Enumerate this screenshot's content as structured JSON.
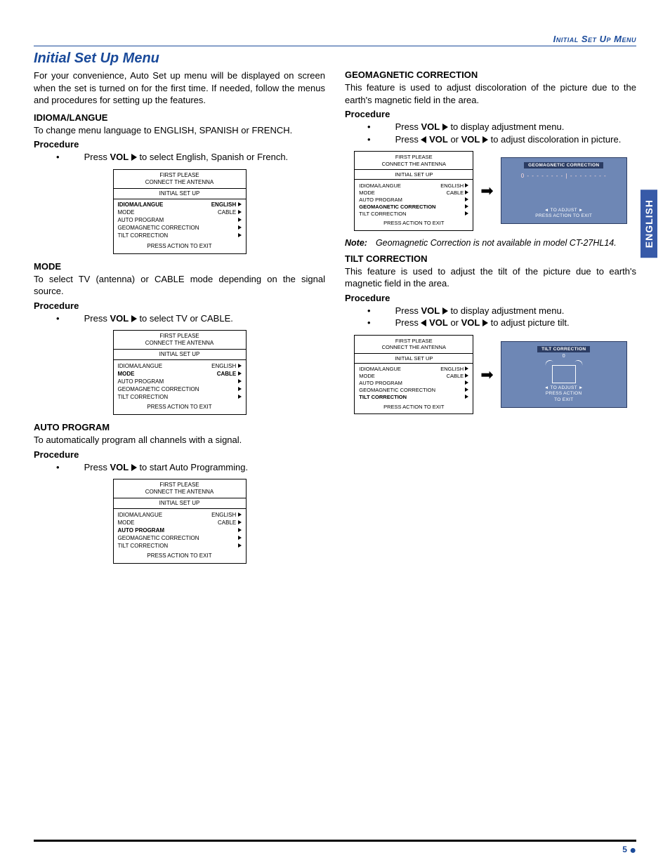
{
  "header": {
    "tab_label": "ENGLISH",
    "breadcrumb": "Initial Set Up Menu"
  },
  "title": "Initial Set Up Menu",
  "intro": "For your convenience, Auto Set up menu will be displayed on screen when the set is turned on for the first time. If needed, follow the menus and procedures for setting up the features.",
  "labels": {
    "procedure": "Procedure",
    "press": "Press ",
    "vol": "VOL",
    "or": " or "
  },
  "osd_common": {
    "top1": "FIRST PLEASE",
    "top2": "CONNECT THE ANTENNA",
    "sub": "INITIAL SET UP",
    "items": {
      "idioma": "IDIOMA/LANGUE",
      "mode": "MODE",
      "auto": "AUTO PROGRAM",
      "geo": "GEOMAGNETIC CORRECTION",
      "tilt": "TILT CORRECTION"
    },
    "vals": {
      "english": "ENGLISH",
      "cable": "CABLE"
    },
    "foot": "PRESS ACTION TO EXIT"
  },
  "sections": {
    "idioma": {
      "head": "IDIOMA/LANGUE",
      "desc": "To change menu language to ENGLISH, SPANISH or FRENCH.",
      "step": " to select English, Spanish or French."
    },
    "mode": {
      "head": "MODE",
      "desc": "To select TV (antenna) or CABLE mode depending on the signal source.",
      "step": " to select TV or CABLE."
    },
    "auto": {
      "head": "AUTO PROGRAM",
      "desc": "To automatically program all channels with a signal.",
      "step": " to start Auto Programming."
    },
    "geo": {
      "head": "GEOMAGNETIC CORRECTION",
      "desc": "This feature is used to adjust discoloration of the picture due to the earth's magnetic field in the area.",
      "step1": " to display adjustment menu.",
      "step2": " to adjust discoloration in picture.",
      "adj_title": "GEOMAGNETIC CORRECTION",
      "adj_scale": "0 - - - - - - - - | - - - - - - - -",
      "adj_foot1": "◄   TO ADJUST   ►",
      "adj_foot2": "PRESS ACTION TO EXIT"
    },
    "tilt": {
      "head": "TILT CORRECTION",
      "desc": "This feature is used to adjust the tilt of the picture due to earth's magnetic field in the area.",
      "step1": " to display adjustment menu.",
      "step2": " to adjust picture tilt.",
      "adj_title": "TILT CORRECTION",
      "adj_zero": "0",
      "adj_foot1": "◄   TO ADJUST   ►",
      "adj_foot2": "PRESS    ACTION",
      "adj_foot3": "TO     EXIT"
    }
  },
  "note": {
    "label": "Note:",
    "text": "Geomagnetic Correction is not available in model CT-27HL14."
  },
  "footer": {
    "page": "5"
  }
}
